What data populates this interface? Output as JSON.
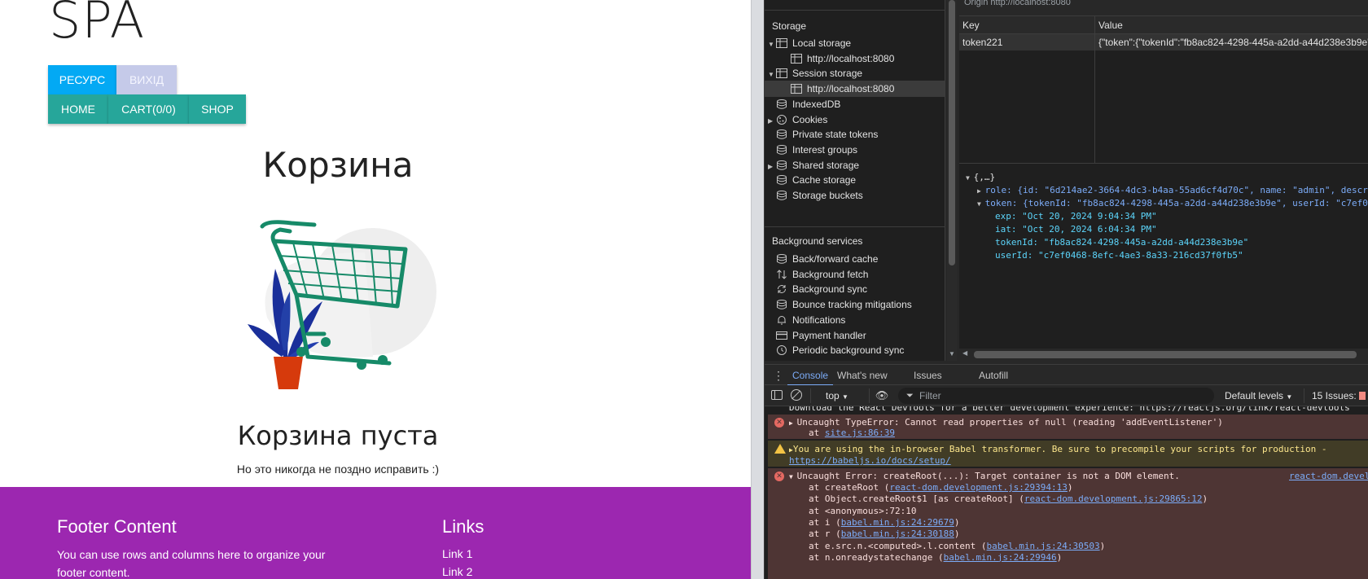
{
  "spa": {
    "title": "SPA",
    "buttons": {
      "resource": "РЕСУРС",
      "exit": "ВИХІД",
      "home": "HOME",
      "cart": "CART(0/0)",
      "shop": "SHOP"
    },
    "cart_title": "Корзина",
    "empty_title": "Корзина пуста",
    "empty_subtitle": "Но это никогда не поздно исправить :)",
    "footer": {
      "content_title": "Footer Content",
      "content_text": "You can use rows and columns here to organize your footer content.",
      "links_title": "Links",
      "links": [
        "Link 1",
        "Link 2"
      ]
    },
    "colors": {
      "resource": "#03a9f4",
      "exit": "#c5cae9",
      "nav": "#26a69a",
      "footer": "#9c27b0"
    }
  },
  "devtools": {
    "origin_label": "Origin   http://localhost:8080",
    "storage_section": "Storage",
    "storage_items": [
      {
        "label": "Local storage",
        "icon": "table-icon",
        "expanded": true
      },
      {
        "label": "http://localhost:8080",
        "icon": "table-icon",
        "child": true
      },
      {
        "label": "Session storage",
        "icon": "table-icon",
        "expanded": true
      },
      {
        "label": "http://localhost:8080",
        "icon": "table-icon",
        "child": true,
        "selected": true
      },
      {
        "label": "IndexedDB",
        "icon": "database-icon"
      },
      {
        "label": "Cookies",
        "icon": "cookie-icon",
        "collapsed": true
      },
      {
        "label": "Private state tokens",
        "icon": "database-icon"
      },
      {
        "label": "Interest groups",
        "icon": "database-icon"
      },
      {
        "label": "Shared storage",
        "icon": "database-icon",
        "collapsed": true
      },
      {
        "label": "Cache storage",
        "icon": "database-icon"
      },
      {
        "label": "Storage buckets",
        "icon": "database-icon"
      }
    ],
    "background_section": "Background services",
    "background_items": [
      {
        "label": "Back/forward cache",
        "icon": "database-icon"
      },
      {
        "label": "Background fetch",
        "icon": "arrows-updown-icon"
      },
      {
        "label": "Background sync",
        "icon": "sync-icon"
      },
      {
        "label": "Bounce tracking mitigations",
        "icon": "database-icon"
      },
      {
        "label": "Notifications",
        "icon": "bell-icon"
      },
      {
        "label": "Payment handler",
        "icon": "card-icon"
      },
      {
        "label": "Periodic background sync",
        "icon": "clock-icon"
      }
    ],
    "table": {
      "key_header": "Key",
      "value_header": "Value",
      "row_key": "token221",
      "row_value": "{\"token\":{\"tokenId\":\"fb8ac824-4298-445a-a2dd-a44d238e3b9e\""
    },
    "preview": [
      "{,…}",
      "role: {id: \"6d214ae2-3664-4dc3-b4aa-55ad6cf4d70c\", name: \"admin\", descr",
      "token: {tokenId: \"fb8ac824-4298-445a-a2dd-a44d238e3b9e\", userId: \"c7ef0",
      "exp: \"Oct 20, 2024 9:04:34 PM\"",
      "iat: \"Oct 20, 2024 6:04:34 PM\"",
      "tokenId: \"fb8ac824-4298-445a-a2dd-a44d238e3b9e\"",
      "userId: \"c7ef0468-8efc-4ae3-8a33-216cd37f0fb5\""
    ],
    "drawer_tabs": [
      "Console",
      "What's new",
      "Issues",
      "Autofill"
    ],
    "toolbar": {
      "context": "top",
      "filter_placeholder": "Filter",
      "levels": "Default levels",
      "issues": "15 Issues:"
    },
    "console": {
      "cutoff_line": "Download the React DevTools for a better development experience: https://reactjs.org/link/react-devtools",
      "error1": "Uncaught TypeError: Cannot read properties of null (reading 'addEventListener')",
      "error1_at": "at",
      "error1_link": "site.js:86:39",
      "warn": "You are using the in-browser Babel transformer. Be sure to precompile your scripts for production -",
      "warn_link": "https://babeljs.io/docs/setup/",
      "error2": "Uncaught Error: createRoot(...): Target container is not a DOM element.",
      "error2_source": "react-dom.develo",
      "stack": [
        {
          "prefix": "at createRoot (",
          "link": "react-dom.development.js:29394:13",
          "suffix": ")"
        },
        {
          "prefix": "at Object.createRoot$1 [as createRoot] (",
          "link": "react-dom.development.js:29865:12",
          "suffix": ")"
        },
        {
          "prefix": "at <anonymous>:72:10",
          "link": "",
          "suffix": ""
        },
        {
          "prefix": "at i (",
          "link": "babel.min.js:24:29679",
          "suffix": ")"
        },
        {
          "prefix": "at r (",
          "link": "babel.min.js:24:30188",
          "suffix": ")"
        },
        {
          "prefix": "at e.src.n.<computed>.l.content (",
          "link": "babel.min.js:24:30503",
          "suffix": ")"
        },
        {
          "prefix": "at n.onreadystatechange (",
          "link": "babel.min.js:24:29946",
          "suffix": ")"
        }
      ]
    }
  }
}
